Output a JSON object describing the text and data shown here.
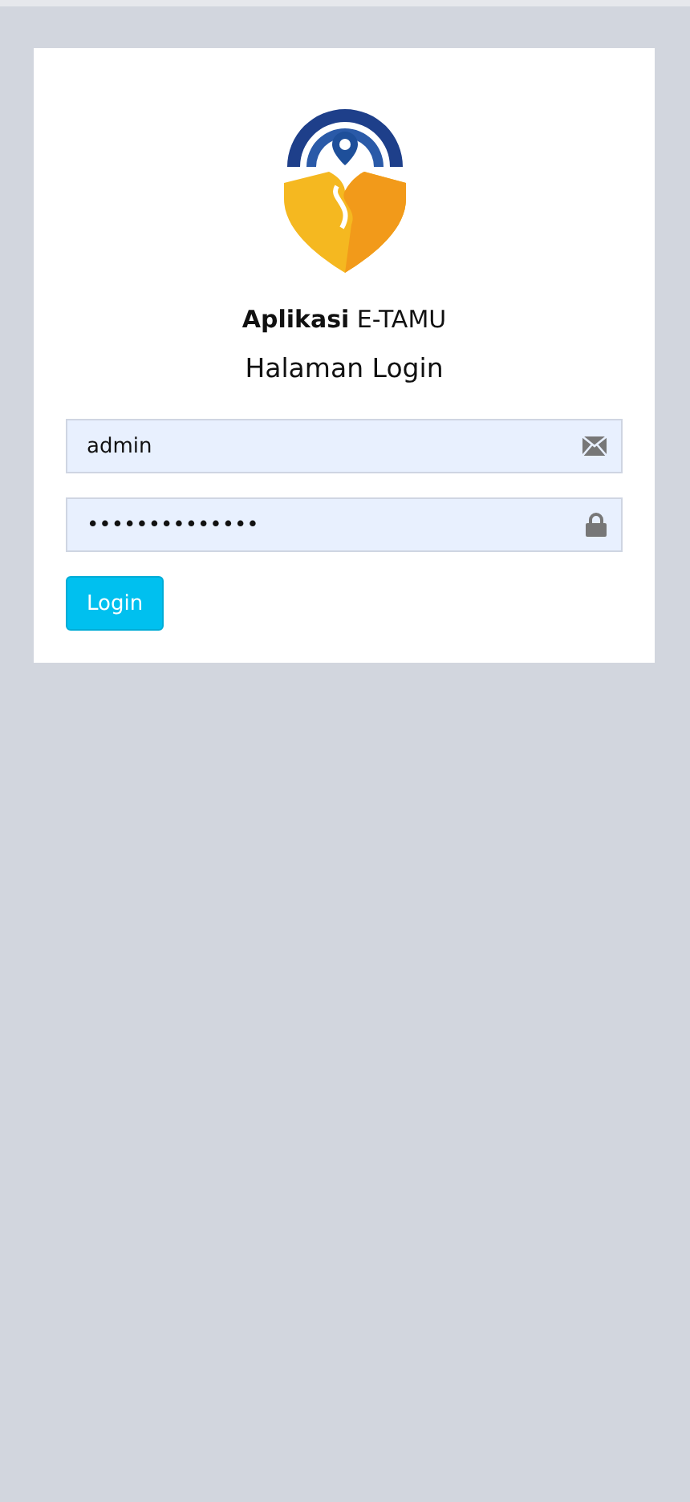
{
  "app_title": "**Aplikasi** E-TAMU",
  "subtitle": "Halaman Login",
  "fields": [
    {
      "kind": "email",
      "value": "admin"
    },
    {
      "kind": "password",
      "value": "••••••••••••••"
    }
  ],
  "button": "Login"
}
